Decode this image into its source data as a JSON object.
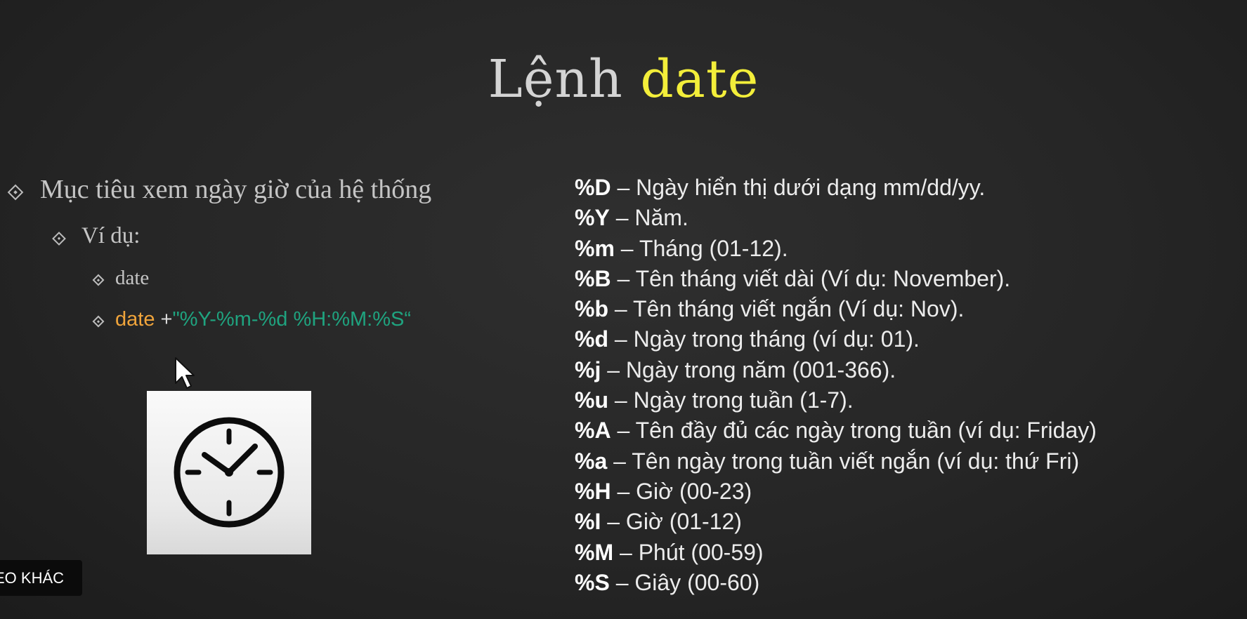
{
  "slide": {
    "title_main": "Lệnh",
    "title_highlight": "date",
    "bullets": {
      "level1": "Mục tiêu xem ngày giờ của hệ thống",
      "level2": "Ví dụ:",
      "example1": "date",
      "example2_cmd": "date",
      "example2_plus": "+",
      "example2_format": "\"%Y-%m-%d %H:%M:%S“"
    },
    "image_icon": "clock-icon",
    "format_specifiers": [
      {
        "code": "%D",
        "desc": " – Ngày hiển thị dưới dạng mm/dd/yy."
      },
      {
        "code": "%Y",
        "desc": " – Năm."
      },
      {
        "code": "%m",
        "desc": " – Tháng (01-12)."
      },
      {
        "code": "%B",
        "desc": " – Tên tháng viết dài (Ví dụ: November)."
      },
      {
        "code": "%b",
        "desc": " – Tên tháng viết ngắn (Ví dụ: Nov)."
      },
      {
        "code": "%d",
        "desc": " – Ngày trong tháng (ví dụ: 01)."
      },
      {
        "code": "%j",
        "desc": " – Ngày trong năm (001-366)."
      },
      {
        "code": "%u",
        "desc": " – Ngày trong tuần (1-7)."
      },
      {
        "code": "%A",
        "desc": " – Tên đầy đủ các ngày trong tuần (ví dụ: Friday)"
      },
      {
        "code": "%a",
        "desc": " – Tên ngày trong tuần viết ngắn (ví dụ: thứ Fri)"
      },
      {
        "code": "%H",
        "desc": " – Giờ (00-23)"
      },
      {
        "code": "%I",
        "desc": " – Giờ (01-12)"
      },
      {
        "code": "%M",
        "desc": " – Phút (00-59)"
      },
      {
        "code": "%S",
        "desc": " – Giây (00-60)"
      }
    ]
  },
  "overlay": {
    "more_videos_label": "EO KHÁC"
  },
  "colors": {
    "title_highlight": "#f3ee3a",
    "command": "#f0a43b",
    "format_string": "#1fa37f",
    "background": "#262626"
  }
}
